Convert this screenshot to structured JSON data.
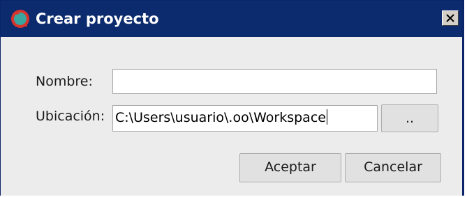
{
  "window": {
    "title": "Crear proyecto",
    "close_glyph": "✕"
  },
  "form": {
    "name_label": "Nombre:",
    "name_value": "",
    "location_label": "Ubicación:",
    "location_value": "C:\\Users\\usuario\\.oo\\Workspace",
    "browse_label": ".."
  },
  "buttons": {
    "accept_label": "Aceptar",
    "cancel_label": "Cancelar"
  },
  "colors": {
    "titlebar": "#0c2a6e",
    "dialog_bg": "#ececec",
    "button_bg": "#e1e1e1"
  }
}
